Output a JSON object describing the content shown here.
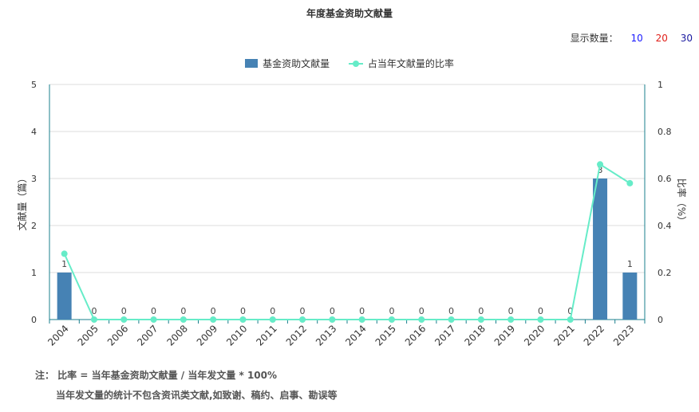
{
  "title": "年度基金资助文献量",
  "count_selector": {
    "label": "显示数量：",
    "options": [
      {
        "label": "10",
        "color": "#1a1aff"
      },
      {
        "label": "20",
        "color": "#e0201a"
      },
      {
        "label": "30",
        "color": "#1a1a9f"
      }
    ]
  },
  "notes": {
    "line1": "注： 比率 = 当年基金资助文献量 / 当年发文量 * 100%",
    "line2": "当年发文量的统计不包含资讯类文献,如致谢、稿约、启事、勘误等"
  },
  "colors": {
    "bar": "#4682b4",
    "line": "#66ecc8",
    "axis": "#1a7f8e",
    "grid": "#dddddd"
  },
  "chart_data": {
    "type": "bar",
    "categories": [
      "2004",
      "2005",
      "2006",
      "2007",
      "2008",
      "2009",
      "2010",
      "2011",
      "2012",
      "2013",
      "2014",
      "2015",
      "2016",
      "2017",
      "2018",
      "2019",
      "2020",
      "2021",
      "2022",
      "2023"
    ],
    "series": [
      {
        "name": "基金资助文献量",
        "type": "bar",
        "axis": "left",
        "values": [
          1,
          0,
          0,
          0,
          0,
          0,
          0,
          0,
          0,
          0,
          0,
          0,
          0,
          0,
          0,
          0,
          0,
          0,
          3,
          1
        ]
      },
      {
        "name": "占当年文献量的比率",
        "type": "line",
        "axis": "right",
        "values": [
          0.28,
          0,
          0,
          0,
          0,
          0,
          0,
          0,
          0,
          0,
          0,
          0,
          0,
          0,
          0,
          0,
          0,
          0,
          0.66,
          0.58
        ]
      }
    ],
    "ylabel": "文献量（篇）",
    "ylabel_right": "比率（%）",
    "ylim": [
      0,
      5
    ],
    "ylim_right": [
      0,
      1
    ],
    "yticks": [
      0,
      1,
      2,
      3,
      4,
      5
    ],
    "yticks_right": [
      "0",
      "0.2",
      "0.4",
      "0.6",
      "0.8",
      "1"
    ],
    "grid": true,
    "legend": "top-center"
  }
}
